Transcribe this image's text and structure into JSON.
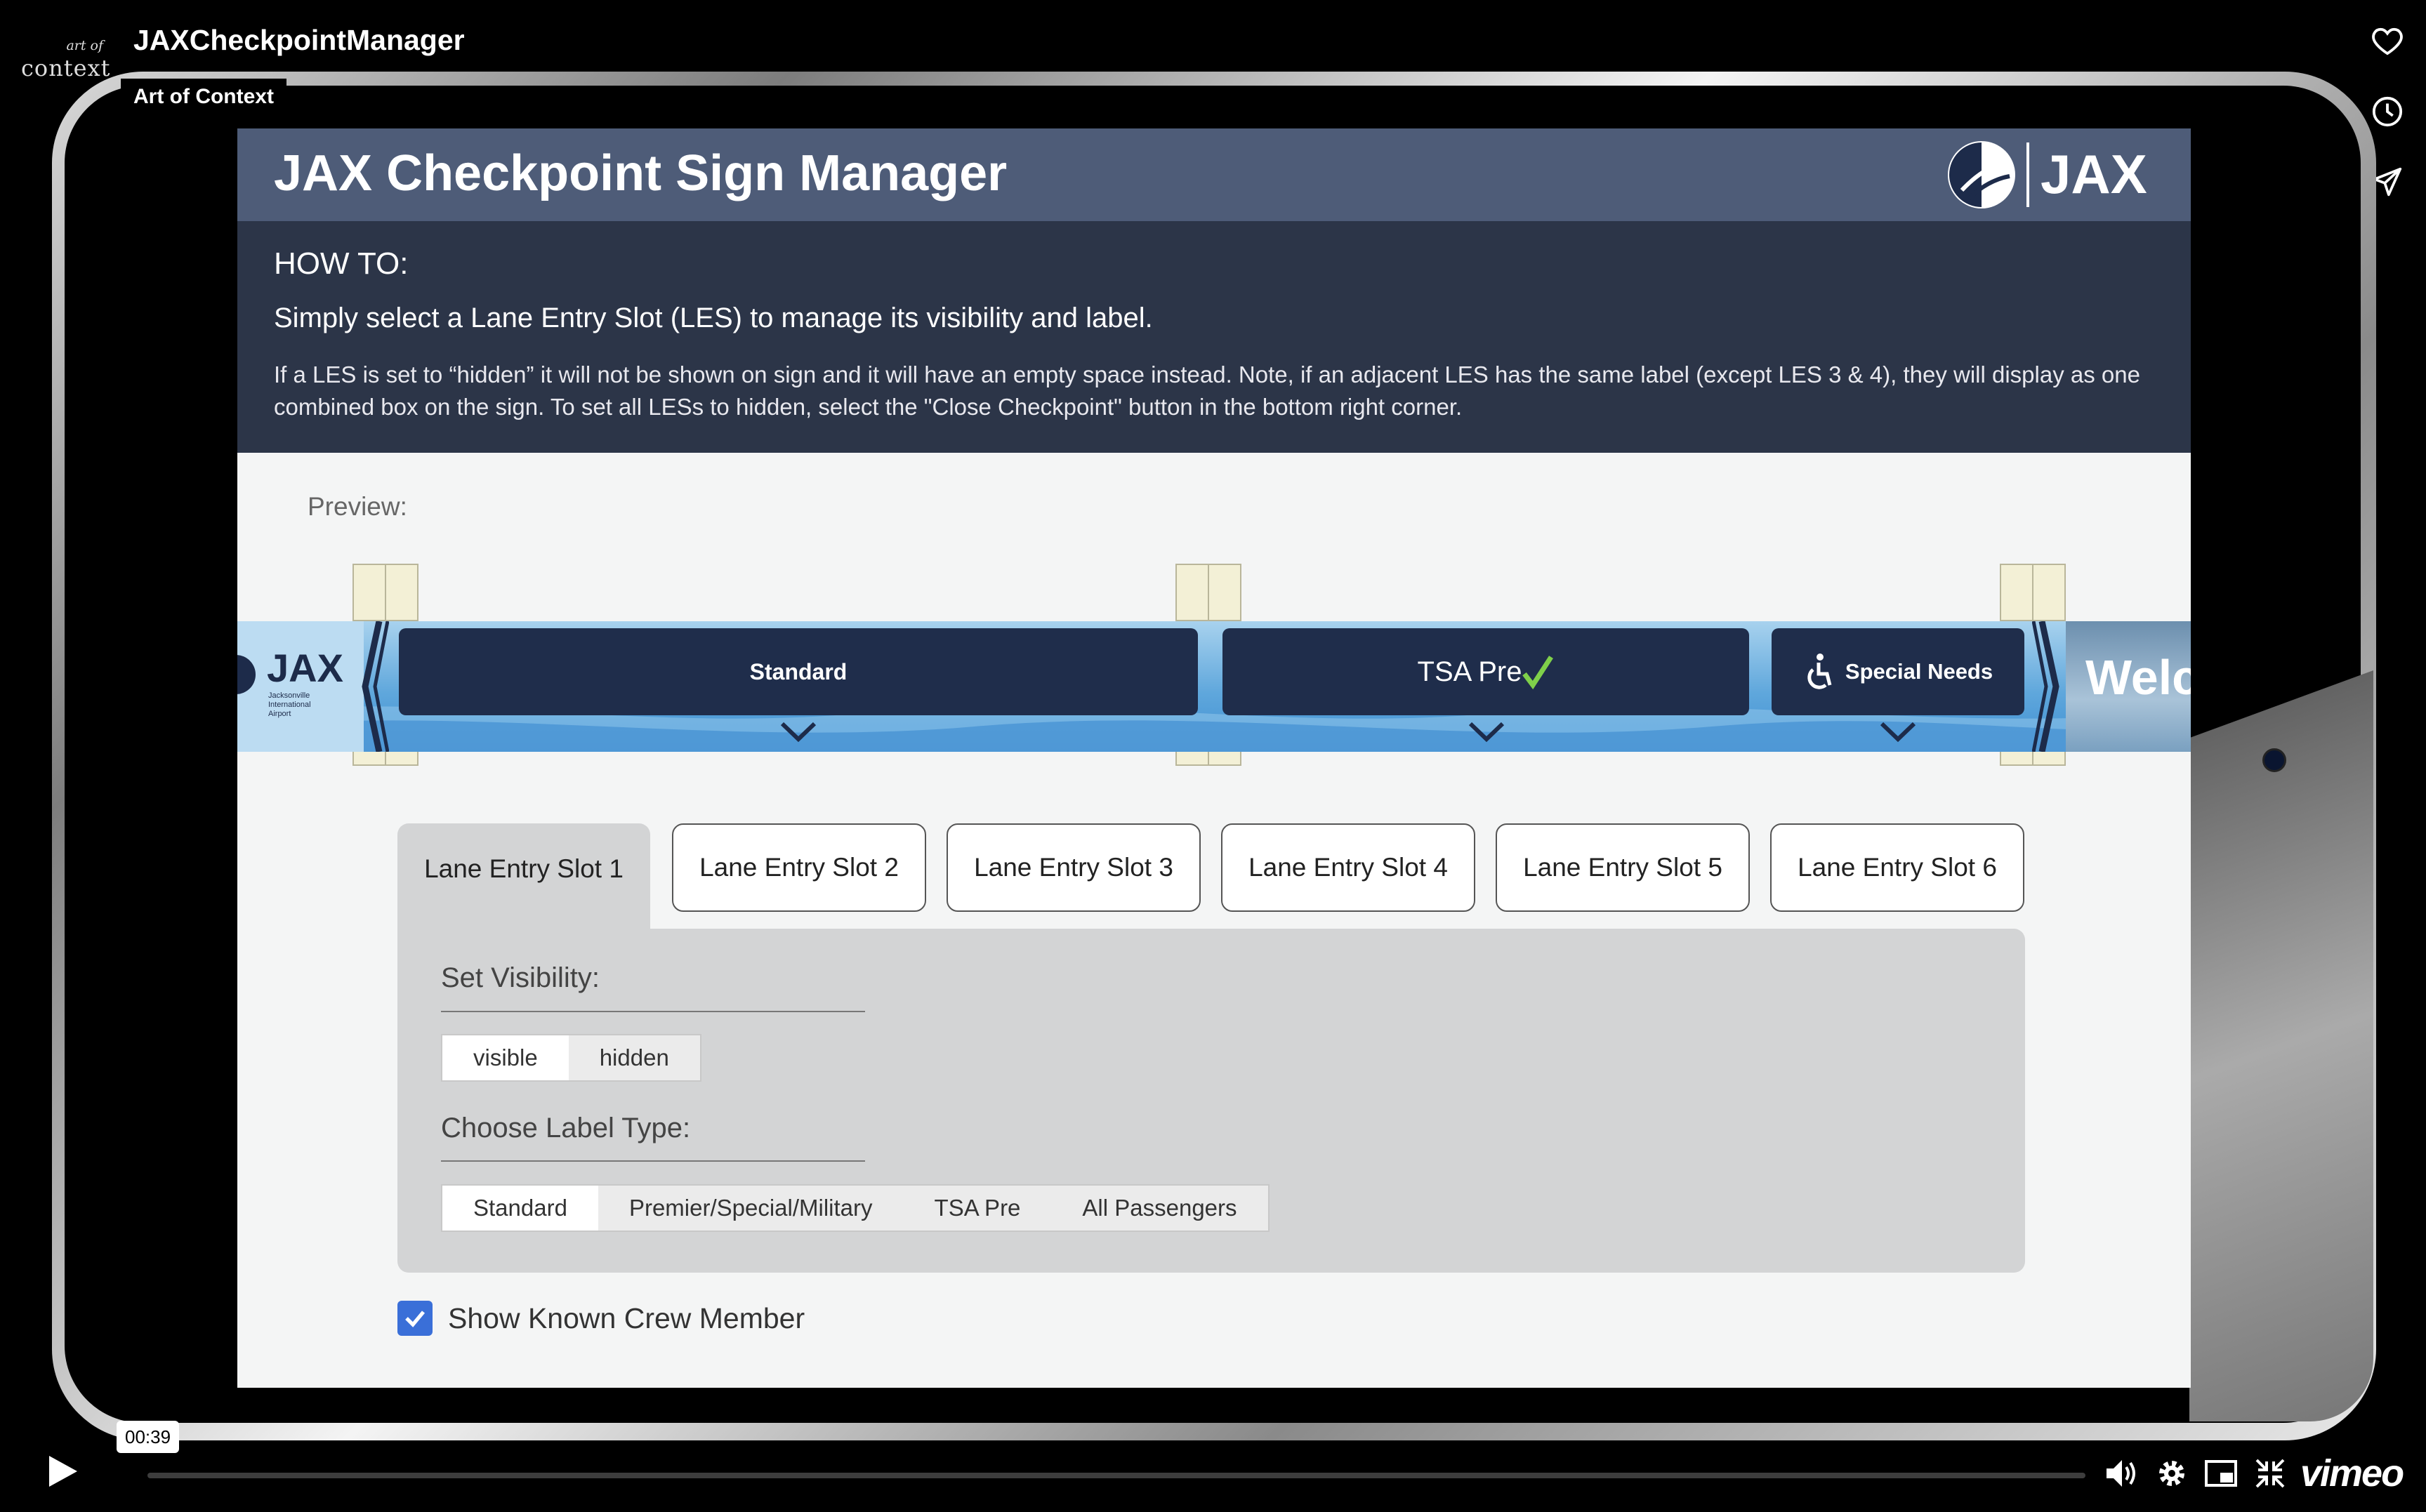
{
  "player": {
    "video_title": "JAXCheckpointManager",
    "author": "Art of Context",
    "logo_line1": "art of",
    "logo_line2": "context",
    "timestamp": "00:39",
    "brand": "vimeo",
    "progress_fraction": 0.0
  },
  "app": {
    "title": "JAX Checkpoint Sign Manager",
    "brand_name": "JAX"
  },
  "howto": {
    "title": "HOW TO:",
    "lead": "Simply select a Lane Entry Slot (LES) to manage its visibility and label.",
    "text": "If a LES is set to “hidden” it will not be shown on sign and it will have an empty space instead. Note, if an adjacent LES has the same label (except LES 3 & 4), they will display as one combined box on the sign. To set all LESs to hidden, select the \"Close Checkpoint\" button in the bottom right corner."
  },
  "preview": {
    "label": "Preview:",
    "sign_logo": "JAX",
    "sign_logo_sub": "Jacksonville International Airport",
    "boxes": [
      "Standard",
      "TSA Pre",
      "Special Needs"
    ],
    "welcome": "Welc"
  },
  "tabs": [
    "Lane Entry Slot 1",
    "Lane Entry Slot 2",
    "Lane Entry Slot 3",
    "Lane Entry Slot 4",
    "Lane Entry Slot 5",
    "Lane Entry Slot 6"
  ],
  "active_tab": 0,
  "visibility": {
    "label": "Set Visibility:",
    "options": [
      "visible",
      "hidden"
    ],
    "selected": "visible"
  },
  "label_type": {
    "label": "Choose Label Type:",
    "options": [
      "Standard",
      "Premier/Special/Military",
      "TSA Pre",
      "All Passengers"
    ],
    "selected": "Standard"
  },
  "known_crew": {
    "label": "Show Known Crew Member",
    "checked": true
  },
  "colors": {
    "header": "#4e5c78",
    "howto_bg": "#2c3548",
    "sign_box": "#1f2d4b",
    "checkbox": "#3a6fd8",
    "tsa_check": "#7fd04a"
  }
}
